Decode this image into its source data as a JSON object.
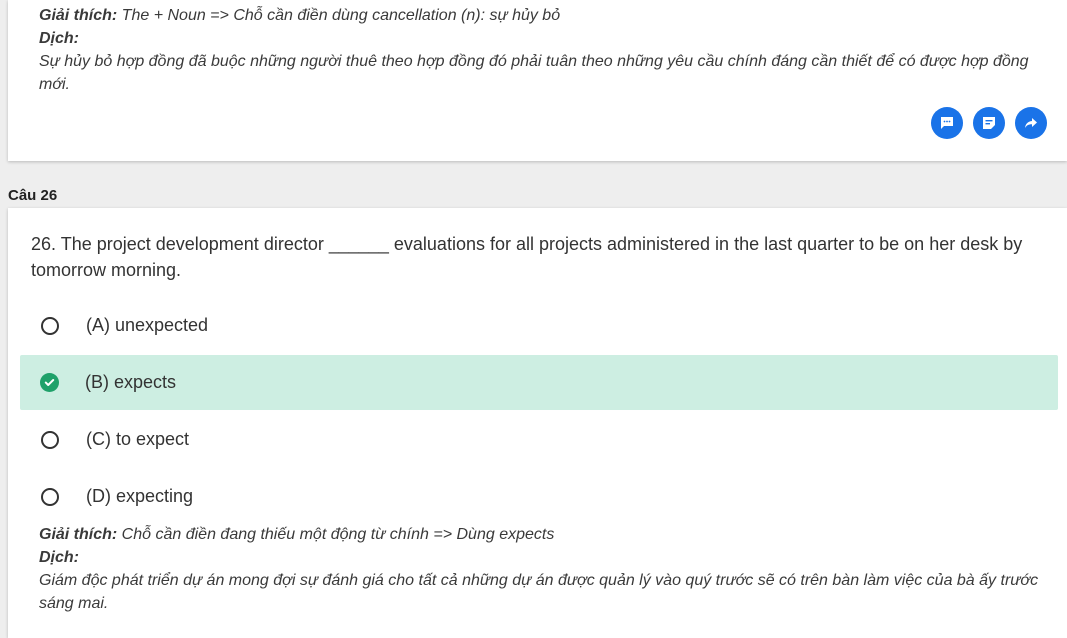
{
  "prev": {
    "explanation_label": "Giải thích:",
    "explanation_text": " The + Noun => Chỗ cần điền dùng cancellation (n): sự hủy bỏ",
    "translation_label": "Dịch:",
    "translation_text": "Sự hủy bỏ hợp đồng đã buộc những người thuê theo hợp đồng đó phải tuân theo những yêu cầu chính đáng cần thiết để có được hợp đồng mới."
  },
  "actions": {
    "colors": {
      "button": "#1a73e8"
    },
    "icons": [
      "comment-icon",
      "note-icon",
      "share-icon"
    ]
  },
  "section": {
    "title": "Câu 26"
  },
  "question": {
    "text": "26. The project development director ______ evaluations for all projects administered in the last quarter to be on her desk by tomorrow morning.",
    "options": [
      {
        "label": "(A) unexpected",
        "selected": false
      },
      {
        "label": "(B) expects",
        "selected": true
      },
      {
        "label": "(C) to expect",
        "selected": false
      },
      {
        "label": "(D) expecting",
        "selected": false
      }
    ],
    "explanation_label": "Giải thích:",
    "explanation_text": " Chỗ cần điền đang thiếu một động từ chính => Dùng expects",
    "translation_label": "Dịch:",
    "translation_text": "Giám độc phát triển dự án mong đợi sự đánh giá cho tất cả những dự án được quản lý vào quý trước sẽ có trên bàn làm việc của bà ấy trước sáng mai."
  },
  "colors": {
    "selected_bg": "#cdeee2",
    "check": "#1fa16a"
  }
}
